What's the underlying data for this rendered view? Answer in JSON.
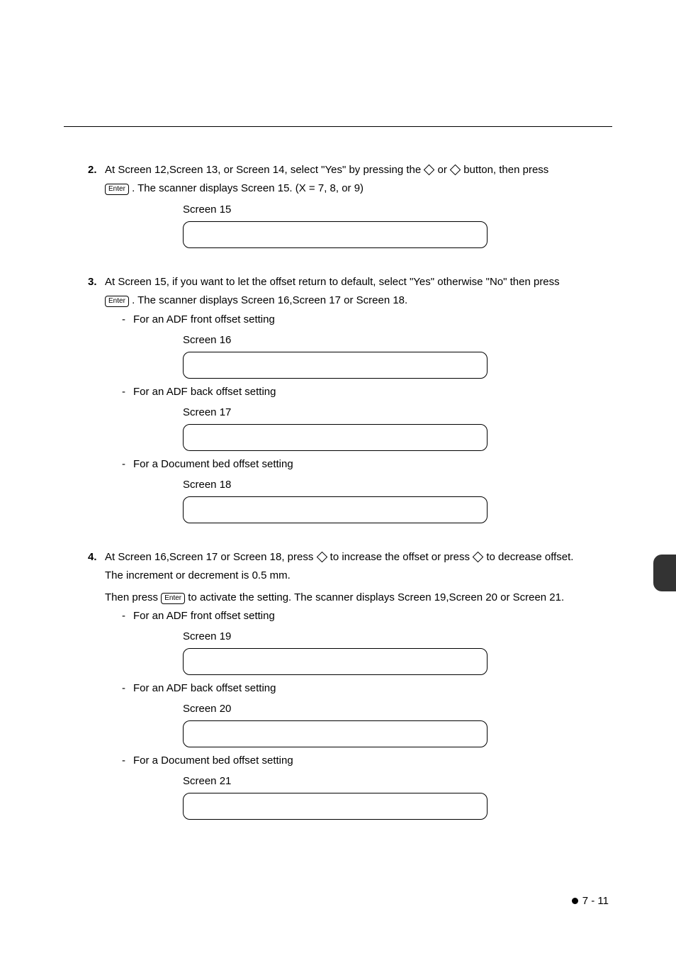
{
  "enter_label": "Enter",
  "step2": {
    "num": "2.",
    "line1a": "At Screen 12,Screen 13, or Screen 14, select \"Yes\" by pressing the ",
    "line1b": " or ",
    "line1c": " button, then press",
    "line2": " . The scanner displays Screen 15. (X = 7, 8, or 9)",
    "screen_label": "Screen 15"
  },
  "step3": {
    "num": "3.",
    "line1": "At Screen 15, if you want to let the offset return to default, select \"Yes\" otherwise \"No\" then press",
    "line2": " . The scanner displays Screen 16,Screen 17 or Screen 18.",
    "items": [
      {
        "text": "For an ADF front offset setting",
        "screen_label": "Screen 16"
      },
      {
        "text": "For an ADF back offset setting",
        "screen_label": "Screen 17"
      },
      {
        "text": "For a Document bed offset setting",
        "screen_label": "Screen 18"
      }
    ]
  },
  "step4": {
    "num": "4.",
    "line1a": "At Screen 16,Screen 17 or Screen 18, press ",
    "line1b": " to increase the offset or press ",
    "line1c": " to decrease offset.",
    "line2": "The increment or decrement is 0.5 mm.",
    "line3a": "Then press ",
    "line3b": " to activate the setting. The scanner displays Screen 19,Screen 20 or Screen 21.",
    "items": [
      {
        "text": "For an ADF front offset setting",
        "screen_label": "Screen 19"
      },
      {
        "text": "For an ADF back offset setting",
        "screen_label": "Screen 20"
      },
      {
        "text": "For a Document bed offset setting",
        "screen_label": "Screen 21"
      }
    ]
  },
  "footer": "7 - 11"
}
